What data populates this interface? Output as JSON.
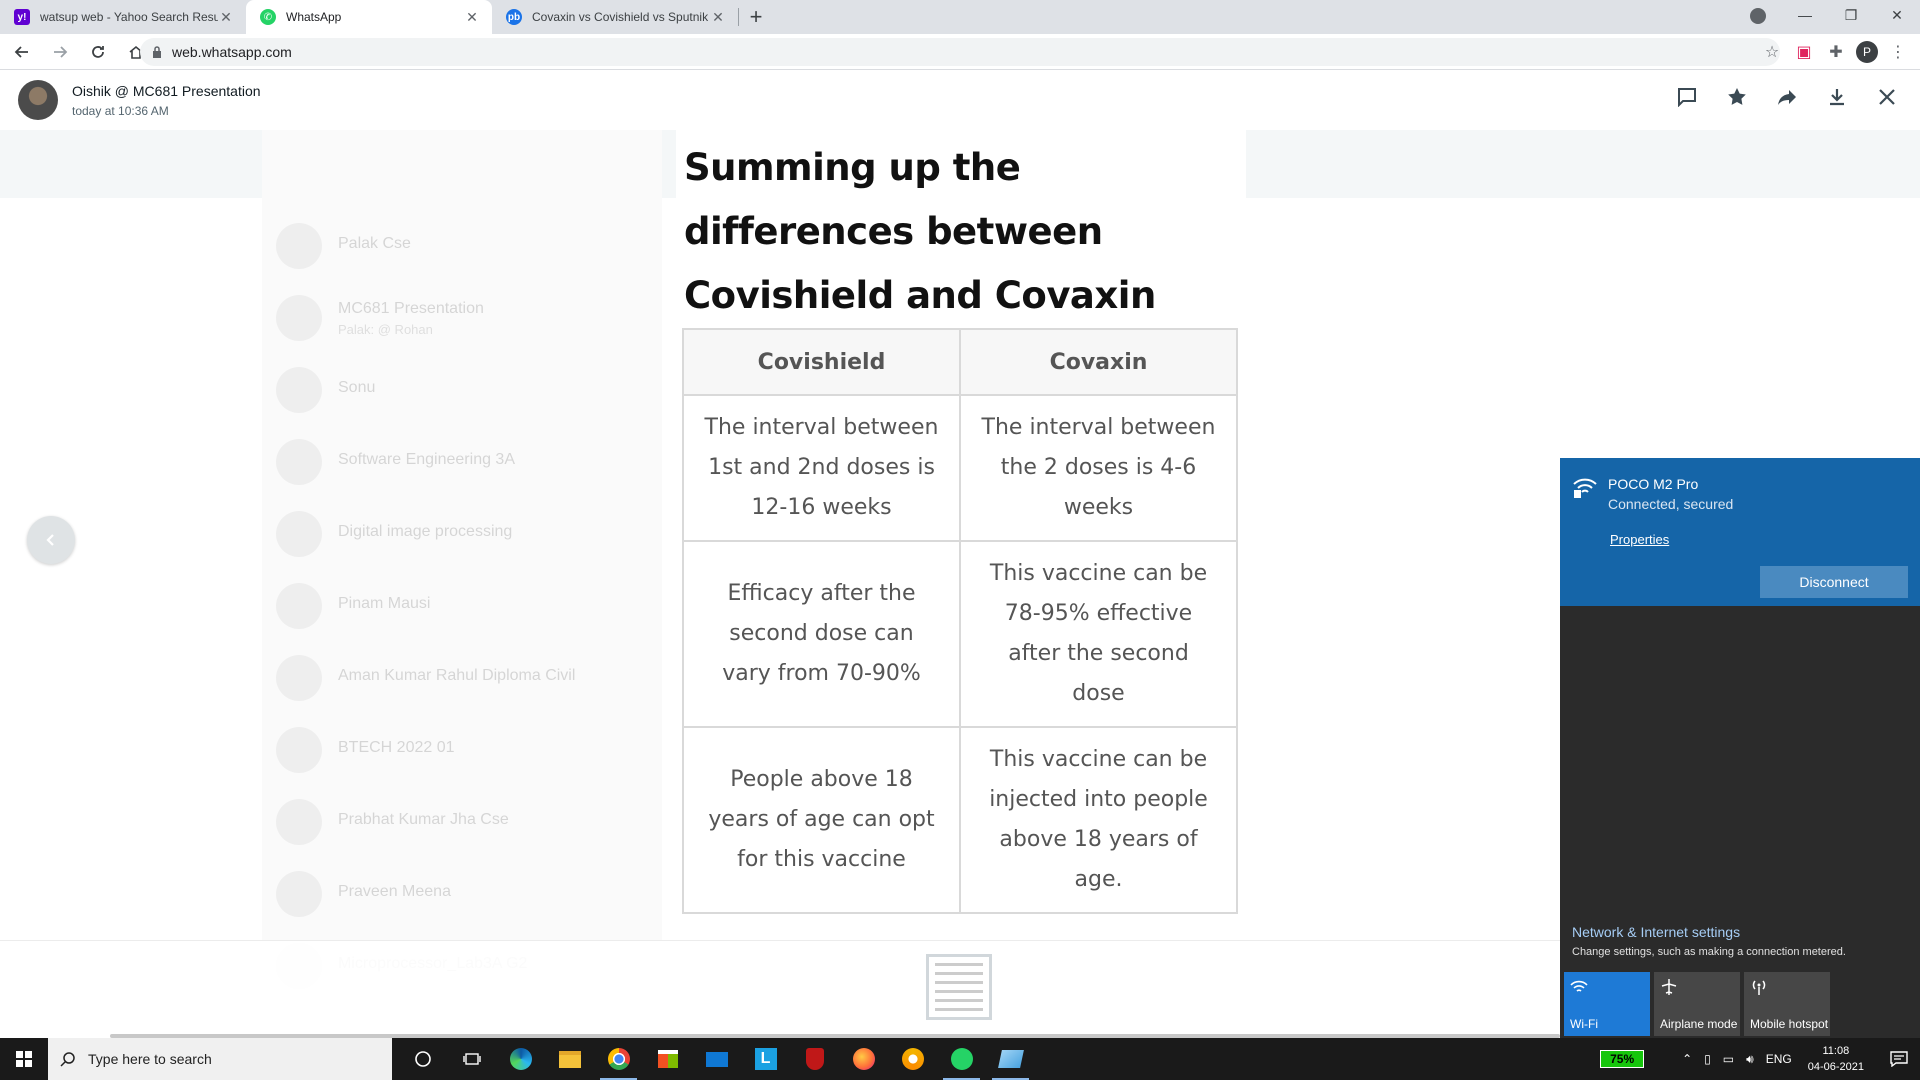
{
  "browser": {
    "tabs": [
      {
        "title": "watsup web - Yahoo Search Resu",
        "favicon": "yahoo-icon",
        "color": "#6001d2",
        "active": false
      },
      {
        "title": "WhatsApp",
        "favicon": "whatsapp-icon",
        "color": "#25d366",
        "active": true
      },
      {
        "title": "Covaxin vs Covishield vs Sputnik",
        "favicon": "pb-icon",
        "color": "#1a73e8",
        "active": false
      }
    ],
    "url": "web.whatsapp.com",
    "profile_initial": "P"
  },
  "viewer": {
    "sender": "Oishik @ MC681 Presentation",
    "timestamp": "today at 10:36 AM"
  },
  "background_chats": [
    {
      "name": "Palak Cse",
      "preview": ""
    },
    {
      "name": "MC681 Presentation",
      "preview": "Palak: @ Rohan"
    },
    {
      "name": "Sonu",
      "preview": ""
    },
    {
      "name": "Software Engineering 3A",
      "preview": ""
    },
    {
      "name": "Digital image processing",
      "preview": ""
    },
    {
      "name": "Pinam Mausi",
      "preview": ""
    },
    {
      "name": "Aman Kumar Rahul Diploma Civil",
      "preview": ""
    },
    {
      "name": "BTECH 2022 01",
      "preview": ""
    },
    {
      "name": "Prabhat Kumar Jha Cse",
      "preview": ""
    },
    {
      "name": "Praveen Meena",
      "preview": ""
    },
    {
      "name": "Microprocessor_Lab3A G2",
      "preview": ""
    }
  ],
  "image": {
    "heading": "Summing up the differences between Covishield and Covaxin",
    "table": {
      "headers": [
        "Covishield",
        "Covaxin"
      ],
      "rows": [
        [
          "The interval between 1st and 2nd doses is 12-16 weeks",
          "The interval between the 2 doses is 4-6 weeks"
        ],
        [
          "Efficacy after the second dose can vary from 70-90%",
          "This vaccine can be 78-95% effective after the second dose"
        ],
        [
          "People above 18 years of age can opt for this vaccine",
          "This vaccine can be injected into people above 18 years of age."
        ]
      ]
    }
  },
  "network": {
    "ssid": "POCO M2 Pro",
    "status": "Connected, secured",
    "properties_label": "Properties",
    "disconnect_label": "Disconnect",
    "settings_label": "Network & Internet settings",
    "settings_sub": "Change settings, such as making a connection metered.",
    "quick_actions": [
      {
        "label": "Wi-Fi",
        "active": true
      },
      {
        "label": "Airplane mode",
        "active": false
      },
      {
        "label": "Mobile hotspot",
        "active": false
      }
    ],
    "accent": "#1565a8"
  },
  "taskbar": {
    "search_placeholder": "Type here to search",
    "battery": "75%",
    "language": "ENG",
    "time": "11:08",
    "date": "04-06-2021"
  }
}
